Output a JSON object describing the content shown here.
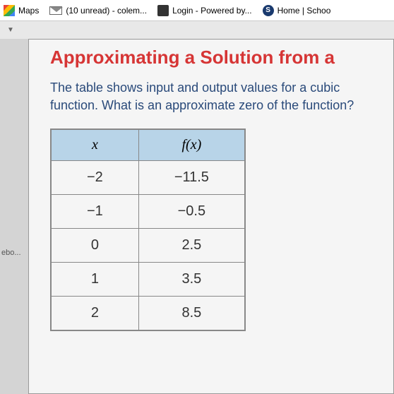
{
  "bookmarks": [
    {
      "label": "Maps",
      "icon": "maps-icon"
    },
    {
      "label": "(10 unread) - colem...",
      "icon": "mail-icon"
    },
    {
      "label": "Login - Powered by...",
      "icon": "login-icon"
    },
    {
      "label": "Home | Schoo",
      "icon": "s-icon",
      "icon_text": "S"
    }
  ],
  "side_label": "ebo...",
  "heading": "Approximating a Solution from a",
  "question": "The table shows input and output values for a cubic function. What is an approximate zero of the function?",
  "table": {
    "headers": {
      "x": "x",
      "fx": "f(x)"
    },
    "rows": [
      {
        "x": "−2",
        "fx": "−11.5"
      },
      {
        "x": "−1",
        "fx": "−0.5"
      },
      {
        "x": "0",
        "fx": "2.5"
      },
      {
        "x": "1",
        "fx": "3.5"
      },
      {
        "x": "2",
        "fx": "8.5"
      }
    ]
  },
  "chart_data": {
    "type": "table",
    "title": "Approximating a Solution from a",
    "columns": [
      "x",
      "f(x)"
    ],
    "rows": [
      [
        -2,
        -11.5
      ],
      [
        -1,
        -0.5
      ],
      [
        0,
        2.5
      ],
      [
        1,
        3.5
      ],
      [
        2,
        8.5
      ]
    ]
  }
}
